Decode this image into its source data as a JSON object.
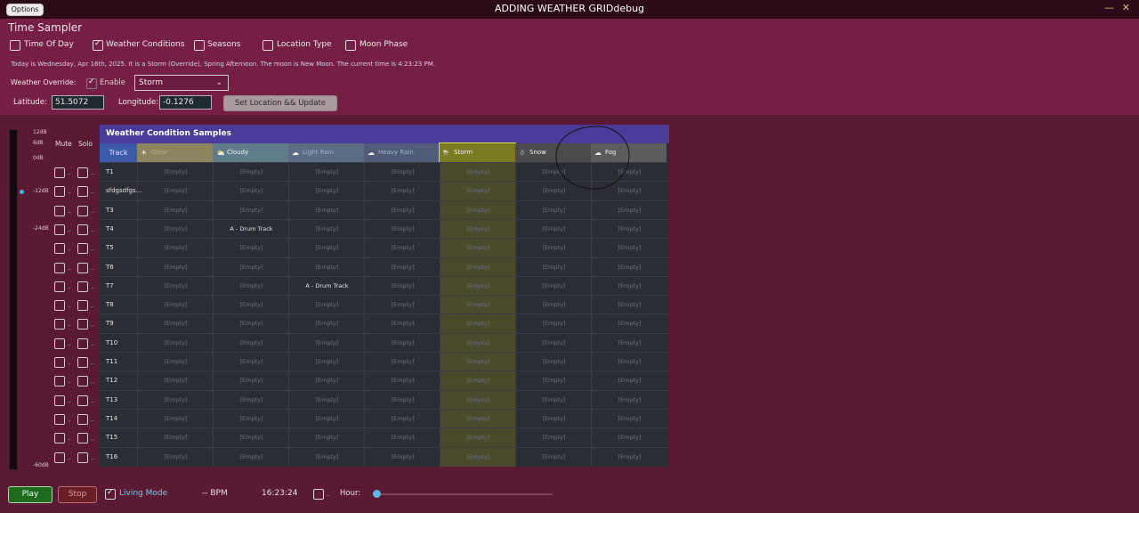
{
  "window": {
    "title": "ADDING WEATHER GRIDdebug",
    "options_label": "Options",
    "minimize_glyph": "—",
    "close_glyph": "✕"
  },
  "panel": {
    "title": "Time Sampler",
    "tabs": [
      {
        "label": "Time Of Day",
        "checked": false
      },
      {
        "label": "Weather Conditions",
        "checked": true
      },
      {
        "label": "Seasons",
        "checked": false
      },
      {
        "label": "Location Type",
        "checked": false
      },
      {
        "label": "Moon Phase",
        "checked": false
      }
    ],
    "info_text": "Today is Wednesday, Apr 16th, 2025. It is a Storm (Override), Spring Afternoon. The moon is New Moon. The current time is 4:23:23 PM.",
    "weather_override_label": "Weather Override:",
    "enable_label": "Enable",
    "enable_checked": true,
    "weather_select": "Storm",
    "latitude_label": "Latitude:",
    "latitude_value": "51.5072",
    "longitude_label": "Longitude:",
    "longitude_value": "-0.1276",
    "set_button": "Set Location && Update"
  },
  "mixer": {
    "db_labels": [
      "12dB",
      "6dB",
      "0dB",
      "-12dB",
      "-24dB",
      "-60dB"
    ],
    "mute_label": "Mute",
    "solo_label": "Solo",
    "row_dots": ".."
  },
  "grid": {
    "title": "Weather Condition Samples",
    "track_header": "Track",
    "columns": [
      {
        "name": "Clear",
        "icon": "sun-icon",
        "glyph": "☀",
        "color": "#8c855e"
      },
      {
        "name": "Cloudy",
        "icon": "cloud-sun-icon",
        "glyph": "⛅",
        "color": "#5e7c8a"
      },
      {
        "name": "Light Rain",
        "icon": "rain-cloud-icon",
        "glyph": "☁",
        "color": "#5d6c85"
      },
      {
        "name": "Heavy Rain",
        "icon": "heavy-rain-icon",
        "glyph": "☁",
        "color": "#4f5b77"
      },
      {
        "name": "Storm",
        "icon": "storm-icon",
        "glyph": "⛈",
        "color": "#7a7a22"
      },
      {
        "name": "Snow",
        "icon": "snow-cloud-icon",
        "glyph": "☃",
        "color": "#4c4a4c"
      },
      {
        "name": "Fog",
        "icon": "fog-icon",
        "glyph": "☁",
        "color": "#5c5c5c"
      }
    ],
    "empty_text": "[Empty]",
    "rows": [
      {
        "track": "T1",
        "cells": [
          "",
          "",
          "",
          "",
          "",
          "",
          ""
        ]
      },
      {
        "track": "sfdgsdfgs...",
        "cells": [
          "",
          "",
          "",
          "",
          "",
          "",
          ""
        ]
      },
      {
        "track": "T3",
        "cells": [
          "",
          "",
          "",
          "",
          "",
          "",
          ""
        ]
      },
      {
        "track": "T4",
        "cells": [
          "",
          "A - Drum Track",
          "",
          "",
          "",
          "",
          ""
        ]
      },
      {
        "track": "T5",
        "cells": [
          "",
          "",
          "",
          "",
          "",
          "",
          ""
        ]
      },
      {
        "track": "T6",
        "cells": [
          "",
          "",
          "",
          "",
          "",
          "",
          ""
        ]
      },
      {
        "track": "T7",
        "cells": [
          "",
          "",
          "A - Drum Track",
          "",
          "",
          "",
          ""
        ]
      },
      {
        "track": "T8",
        "cells": [
          "",
          "",
          "",
          "",
          "",
          "",
          ""
        ]
      },
      {
        "track": "T9",
        "cells": [
          "",
          "",
          "",
          "",
          "",
          "",
          ""
        ]
      },
      {
        "track": "T10",
        "cells": [
          "",
          "",
          "",
          "",
          "",
          "",
          ""
        ]
      },
      {
        "track": "T11",
        "cells": [
          "",
          "",
          "",
          "",
          "",
          "",
          ""
        ]
      },
      {
        "track": "T12",
        "cells": [
          "",
          "",
          "",
          "",
          "",
          "",
          ""
        ]
      },
      {
        "track": "T13",
        "cells": [
          "",
          "",
          "",
          "",
          "",
          "",
          ""
        ]
      },
      {
        "track": "T14",
        "cells": [
          "",
          "",
          "",
          "",
          "",
          "",
          ""
        ]
      },
      {
        "track": "T15",
        "cells": [
          "",
          "",
          "",
          "",
          "",
          "",
          ""
        ]
      },
      {
        "track": "T16",
        "cells": [
          "",
          "",
          "",
          "",
          "",
          "",
          ""
        ]
      }
    ]
  },
  "transport": {
    "play_label": "Play",
    "stop_label": "Stop",
    "living_mode_label": "Living Mode",
    "living_mode_checked": true,
    "bpm_text": "-- BPM",
    "clock_text": "16:23:24",
    "hour_dots": "..",
    "hour_label": "Hour:",
    "hour_progress": 0.0
  }
}
